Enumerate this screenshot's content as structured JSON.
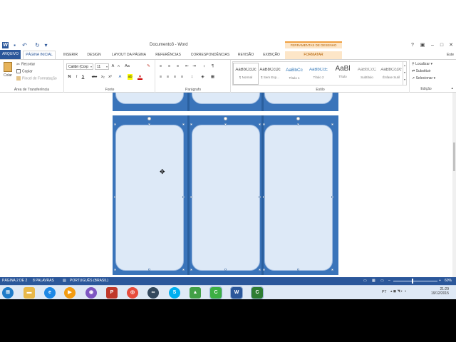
{
  "window": {
    "title": "Documento3 - Word",
    "contextual_header": "FERRAMENTAS DE DESENHO",
    "help_label": "?",
    "account_label": "Este"
  },
  "tabs": [
    "ARQUIVO",
    "PÁGINA INICIAL",
    "INSERIR",
    "DESIGN",
    "LAYOUT DA PÁGINA",
    "REFERÊNCIAS",
    "CORRESPONDÊNCIAS",
    "REVISÃO",
    "EXIBIÇÃO",
    "FORMATAR"
  ],
  "clipboard": {
    "paste": "Colar",
    "cut": "Recortar",
    "copy": "Copiar",
    "format_painter": "Pincel de Formatação",
    "label": "Área de Transferência"
  },
  "font": {
    "family": "Calibri (Corp",
    "size": "11",
    "label": "Fonte",
    "buttons": [
      "N",
      "I",
      "S",
      "abc",
      "x₂",
      "x²"
    ]
  },
  "paragraph": {
    "label": "Parágrafo"
  },
  "styles": {
    "label": "Estilo",
    "items": [
      {
        "sample": "AaBbCcDc",
        "name": "¶ Normal"
      },
      {
        "sample": "AaBbCcDc",
        "name": "¶ Sem Esp..."
      },
      {
        "sample": "AaBbCc",
        "name": "Título 1"
      },
      {
        "sample": "AaBbCcE",
        "name": "Título 2"
      },
      {
        "sample": "AaBl",
        "name": "Título"
      },
      {
        "sample": "AaBbCcC",
        "name": "Subtítulo"
      },
      {
        "sample": "AaBbCcDc",
        "name": "Ênfase Sutil"
      }
    ]
  },
  "editing": {
    "find": "Localizar",
    "replace": "Substituir",
    "select": "Selecionar",
    "label": "Edição"
  },
  "status": {
    "page": "PÁGINA 2 DE 2",
    "words": "8 PALAVRAS",
    "language": "PORTUGUÊS (BRASIL)",
    "zoom": "60%"
  },
  "tray": {
    "lang": "PT",
    "time": "21:29",
    "date": "19/12/2015"
  },
  "colors": {
    "word_blue": "#2b579a",
    "shape_blue": "#3a74ba",
    "card_fill": "#dde9f7"
  }
}
